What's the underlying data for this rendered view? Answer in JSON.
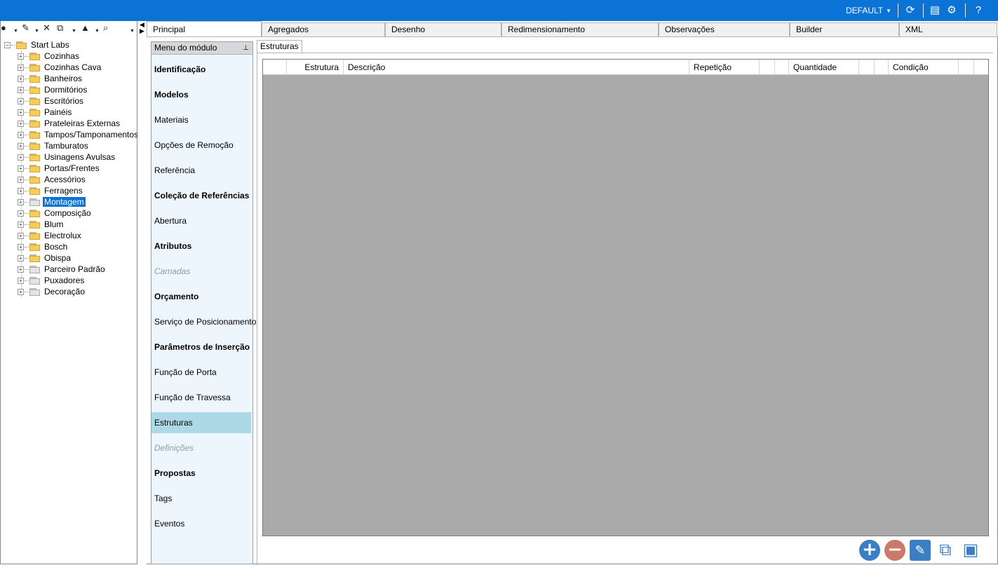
{
  "titlebar": {
    "profile": "DEFAULT",
    "icons": [
      "update-icon",
      "layout-icon",
      "settings-icon",
      "help-icon"
    ]
  },
  "tree": {
    "root": "Start Labs",
    "items": [
      {
        "label": "Cozinhas",
        "folder": "yellow"
      },
      {
        "label": "Cozinhas Cava",
        "folder": "yellow"
      },
      {
        "label": "Banheiros",
        "folder": "yellow"
      },
      {
        "label": "Dormitórios",
        "folder": "yellow"
      },
      {
        "label": "Escritórios",
        "folder": "yellow"
      },
      {
        "label": "Painéis",
        "folder": "yellow"
      },
      {
        "label": "Prateleiras Externas",
        "folder": "yellow"
      },
      {
        "label": "Tampos/Tamponamentos",
        "folder": "yellow"
      },
      {
        "label": "Tamburatos",
        "folder": "yellow"
      },
      {
        "label": "Usinagens Avulsas",
        "folder": "yellow"
      },
      {
        "label": "Portas/Frentes",
        "folder": "yellow"
      },
      {
        "label": "Acessórios",
        "folder": "yellow"
      },
      {
        "label": "Ferragens",
        "folder": "yellow"
      },
      {
        "label": "Montagem",
        "folder": "gray",
        "selected": true
      },
      {
        "label": "Composição",
        "folder": "yellow"
      },
      {
        "label": "Blum",
        "folder": "yellow"
      },
      {
        "label": "Electrolux",
        "folder": "yellow"
      },
      {
        "label": "Bosch",
        "folder": "yellow"
      },
      {
        "label": "Obispa",
        "folder": "yellow"
      },
      {
        "label": "Parceiro Padrão",
        "folder": "gray"
      },
      {
        "label": "Puxadores",
        "folder": "gray"
      },
      {
        "label": "Decoração",
        "folder": "gray"
      }
    ]
  },
  "tabs": [
    "Principal",
    "Agregados",
    "Desenho",
    "Redimensionamento",
    "Observações",
    "Builder",
    "XML"
  ],
  "menu": {
    "header": "Menu do módulo",
    "items": [
      {
        "label": "Identificação",
        "style": "bold"
      },
      {
        "label": "Modelos",
        "style": "bold"
      },
      {
        "label": "Materiais",
        "style": "normal"
      },
      {
        "label": "Opções de Remoção",
        "style": "normal"
      },
      {
        "label": "Referência",
        "style": "normal"
      },
      {
        "label": "Coleção de Referências",
        "style": "bold"
      },
      {
        "label": "Abertura",
        "style": "normal"
      },
      {
        "label": "Atributos",
        "style": "bold"
      },
      {
        "label": "Camadas",
        "style": "disabled"
      },
      {
        "label": "Orçamento",
        "style": "bold"
      },
      {
        "label": "Serviço de Posicionamento",
        "style": "normal"
      },
      {
        "label": "Parâmetros de Inserção",
        "style": "bold"
      },
      {
        "label": "Função de Porta",
        "style": "normal"
      },
      {
        "label": "Função de Travessa",
        "style": "normal"
      },
      {
        "label": "Estruturas",
        "style": "active"
      },
      {
        "label": "Definições",
        "style": "disabled"
      },
      {
        "label": "Propostas",
        "style": "bold"
      },
      {
        "label": "Tags",
        "style": "normal"
      },
      {
        "label": "Eventos",
        "style": "normal"
      }
    ]
  },
  "subtab": "Estruturas",
  "grid": {
    "columns": [
      "Estrutura",
      "Descrição",
      "Repetição",
      "Quantidade",
      "Condição"
    ]
  },
  "actions": [
    "add-icon",
    "remove-icon",
    "edit-icon",
    "copy-icon",
    "paste-icon"
  ]
}
